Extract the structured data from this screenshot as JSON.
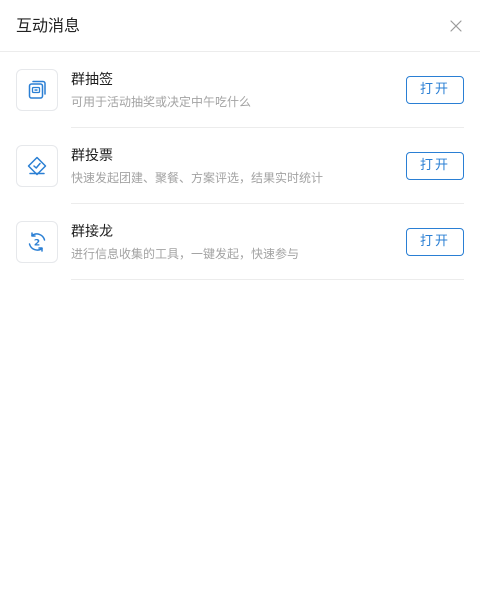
{
  "header": {
    "title": "互动消息",
    "close_icon": "close-icon"
  },
  "colors": {
    "accent": "#2a7fd4",
    "title_text": "#1f1f1f",
    "desc_text": "#a3a3a3",
    "divider": "#ececec"
  },
  "items": [
    {
      "name": "群抽签",
      "description": "可用于活动抽奖或决定中午吃什么",
      "icon": "lottery-icon",
      "button_label": "打开"
    },
    {
      "name": "群投票",
      "description": "快速发起团建、聚餐、方案评选，结果实时统计",
      "icon": "vote-icon",
      "button_label": "打开"
    },
    {
      "name": "群接龙",
      "description": "进行信息收集的工具，一键发起，快速参与",
      "icon": "relay-icon",
      "button_label": "打开"
    }
  ]
}
